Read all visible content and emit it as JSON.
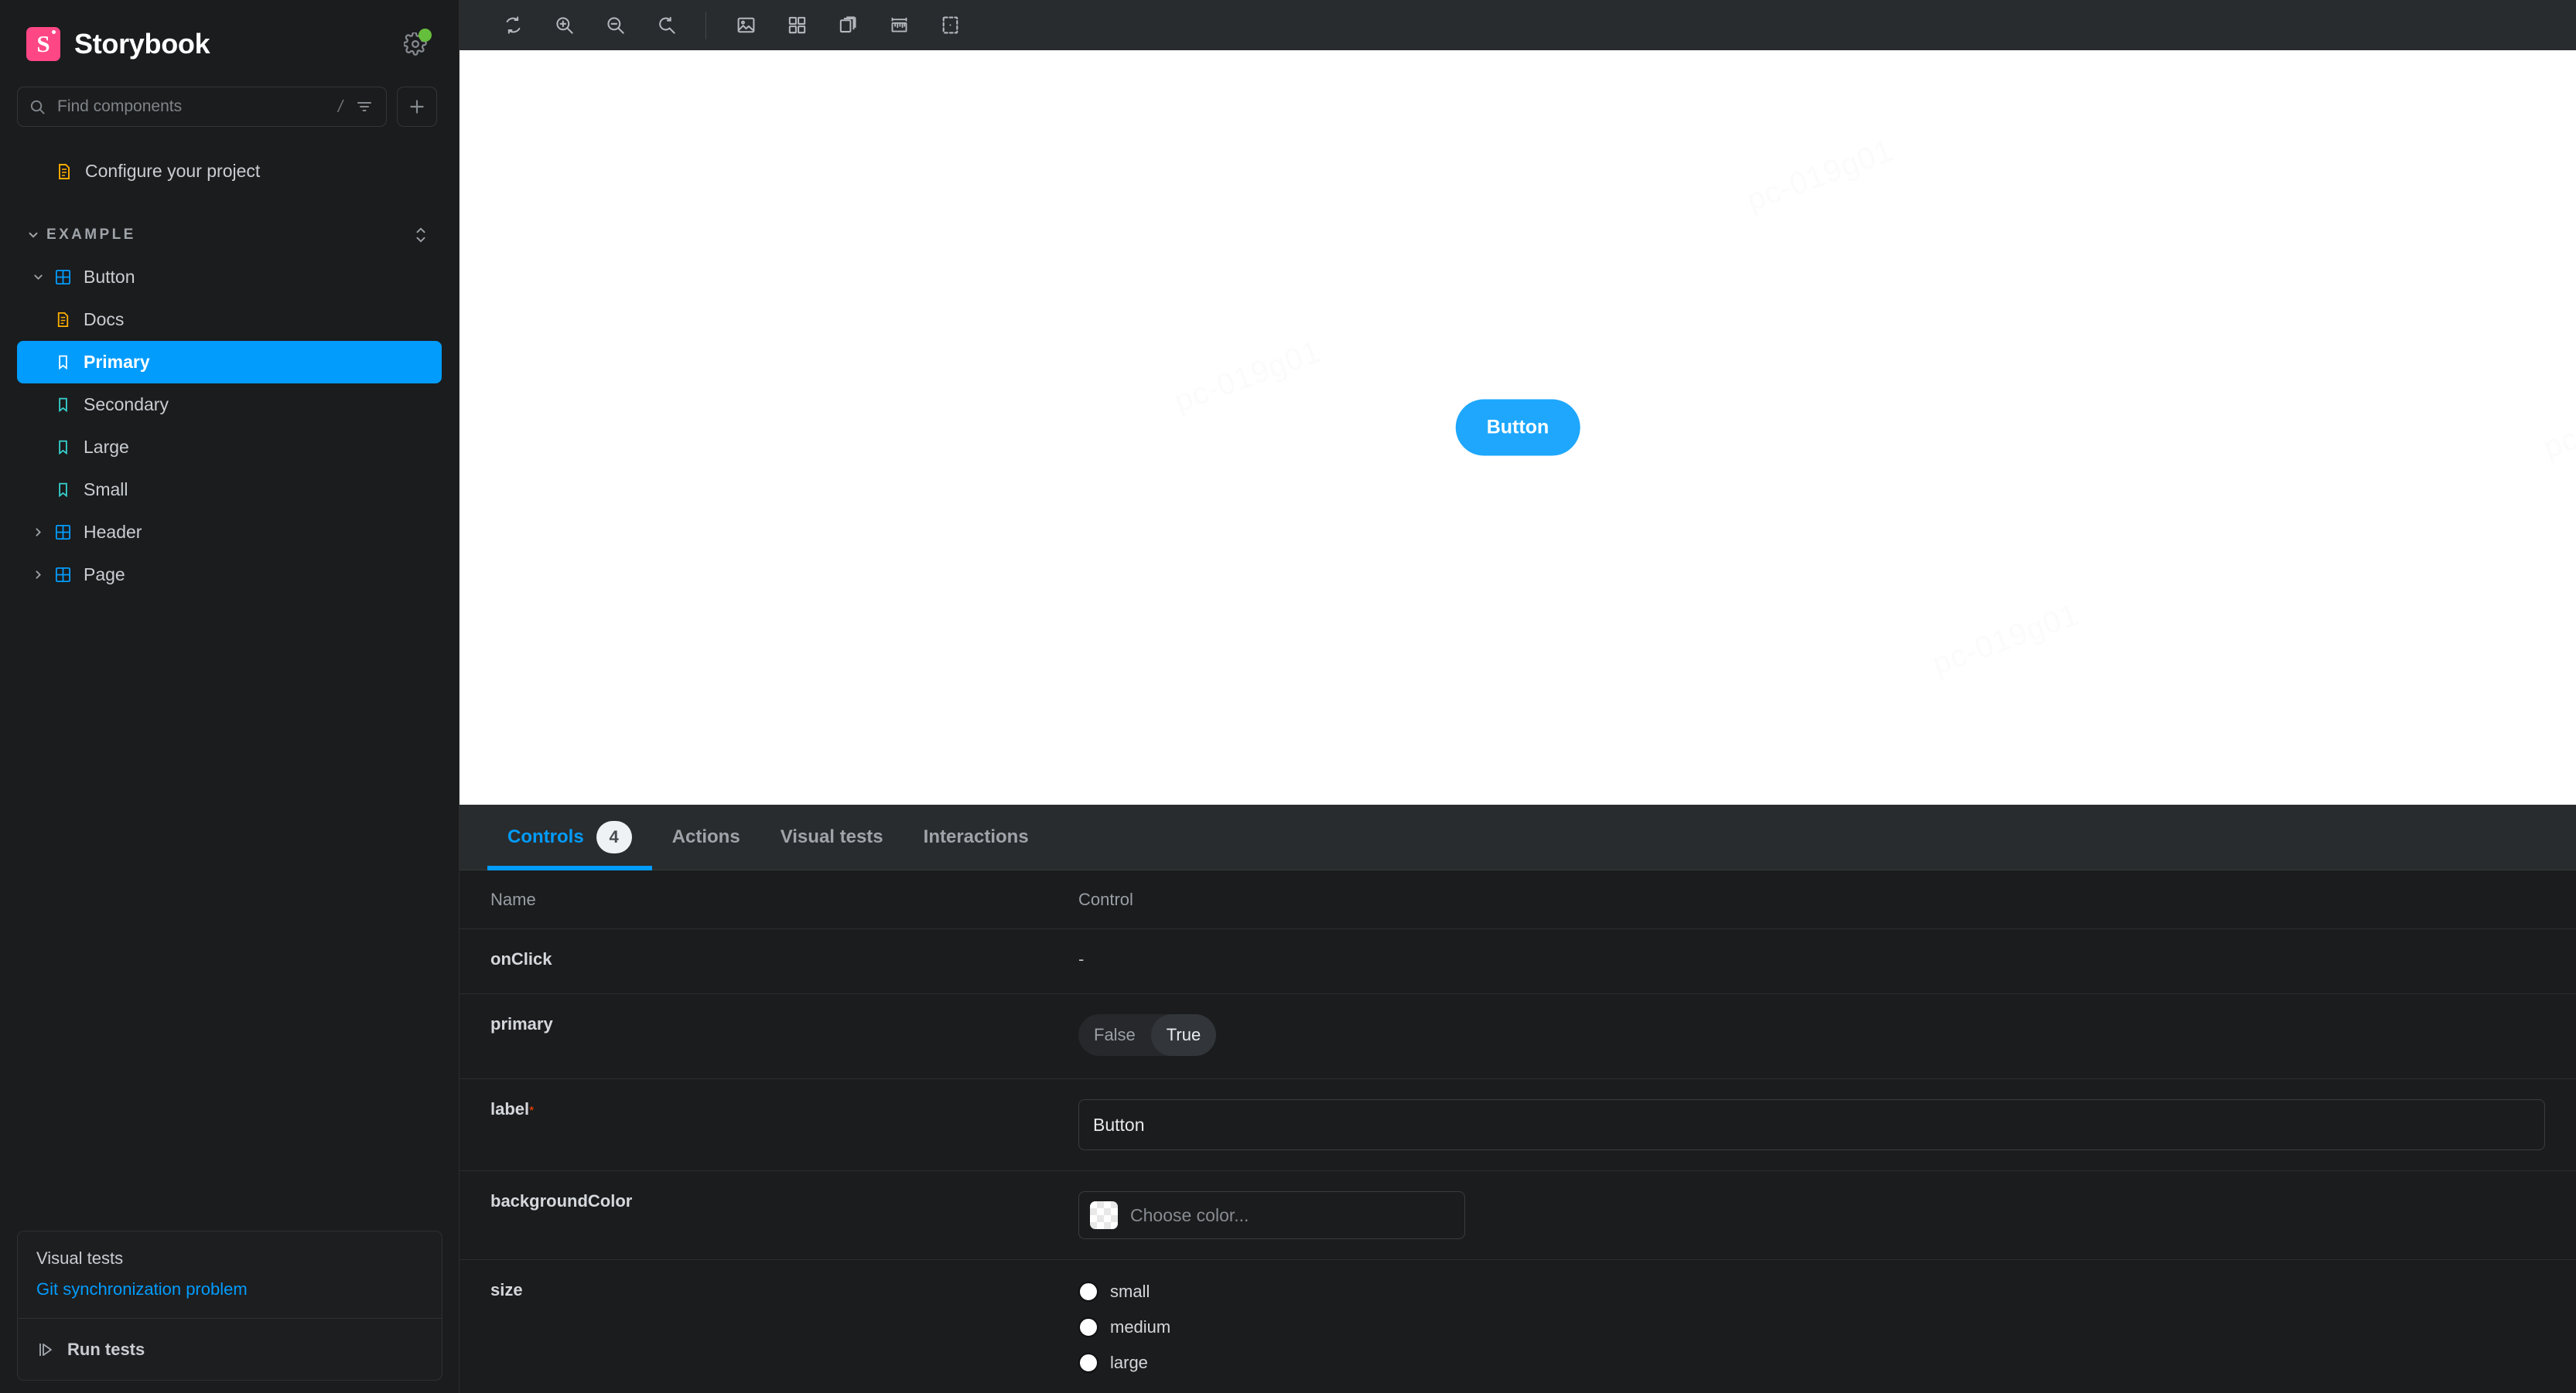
{
  "app": {
    "brand": "Storybook",
    "logo_color": "#FF4785",
    "accent_color": "#029CFD",
    "preview_accent": "#1EA7FD",
    "status_dot_color": "#66BF3C"
  },
  "sidebar": {
    "search": {
      "placeholder": "Find components",
      "shortcut_hint": "/"
    },
    "icons": {
      "gear": "gear-icon",
      "search": "search-icon",
      "filter": "filter-icon",
      "add": "plus-icon"
    },
    "top_items": [
      {
        "label": "Configure your project",
        "icon": "document-icon"
      }
    ],
    "group": {
      "label": "EXAMPLE",
      "expanded": true
    },
    "tree": [
      {
        "label": "Button",
        "icon": "component-icon",
        "type": "component",
        "level": 0,
        "expanded": true,
        "selected": false
      },
      {
        "label": "Docs",
        "icon": "document-icon",
        "type": "docs",
        "level": 1,
        "expanded": false,
        "selected": false
      },
      {
        "label": "Primary",
        "icon": "story-icon",
        "type": "story",
        "level": 1,
        "expanded": false,
        "selected": true
      },
      {
        "label": "Secondary",
        "icon": "story-icon",
        "type": "story",
        "level": 1,
        "expanded": false,
        "selected": false
      },
      {
        "label": "Large",
        "icon": "story-icon",
        "type": "story",
        "level": 1,
        "expanded": false,
        "selected": false
      },
      {
        "label": "Small",
        "icon": "story-icon",
        "type": "story",
        "level": 1,
        "expanded": false,
        "selected": false
      },
      {
        "label": "Header",
        "icon": "component-icon",
        "type": "component",
        "level": 0,
        "expanded": false,
        "selected": false
      },
      {
        "label": "Page",
        "icon": "component-icon",
        "type": "component",
        "level": 0,
        "expanded": false,
        "selected": false
      }
    ],
    "visual_tests_card": {
      "title": "Visual tests",
      "status_link": "Git synchronization problem",
      "run_label": "Run tests",
      "run_icon": "play-icon"
    }
  },
  "toolbar": {
    "buttons": [
      {
        "name": "remount-icon",
        "title": "Remount component"
      },
      {
        "name": "zoom-in-icon",
        "title": "Zoom in"
      },
      {
        "name": "zoom-out-icon",
        "title": "Zoom out"
      },
      {
        "name": "zoom-reset-icon",
        "title": "Reset zoom"
      },
      {
        "name": "backgrounds-icon",
        "title": "Change background"
      },
      {
        "name": "grid-icon",
        "title": "Apply grid"
      },
      {
        "name": "viewport-icon",
        "title": "Change viewport"
      },
      {
        "name": "measure-icon",
        "title": "Enable measure"
      },
      {
        "name": "outline-icon",
        "title": "Apply outlines"
      }
    ]
  },
  "canvas": {
    "watermark_text": "pc-019g01",
    "preview_button_label": "Button",
    "background": "#ffffff"
  },
  "panel": {
    "tabs": [
      {
        "label": "Controls",
        "badge": "4",
        "active": true
      },
      {
        "label": "Actions",
        "badge": "",
        "active": false
      },
      {
        "label": "Visual tests",
        "badge": "",
        "active": false
      },
      {
        "label": "Interactions",
        "badge": "",
        "active": false
      }
    ],
    "table": {
      "headers": {
        "name": "Name",
        "control": "Control"
      },
      "rows": [
        {
          "name": "onClick",
          "required": false,
          "control_type": "none",
          "value": "-"
        },
        {
          "name": "primary",
          "required": false,
          "control_type": "boolean",
          "options": [
            "False",
            "True"
          ],
          "value": "True"
        },
        {
          "name": "label",
          "required": true,
          "control_type": "text",
          "value": "Button",
          "placeholder": ""
        },
        {
          "name": "backgroundColor",
          "required": false,
          "control_type": "color",
          "value": "",
          "placeholder": "Choose color..."
        },
        {
          "name": "size",
          "required": false,
          "control_type": "radio",
          "options": [
            "small",
            "medium",
            "large"
          ],
          "value": ""
        }
      ]
    }
  }
}
